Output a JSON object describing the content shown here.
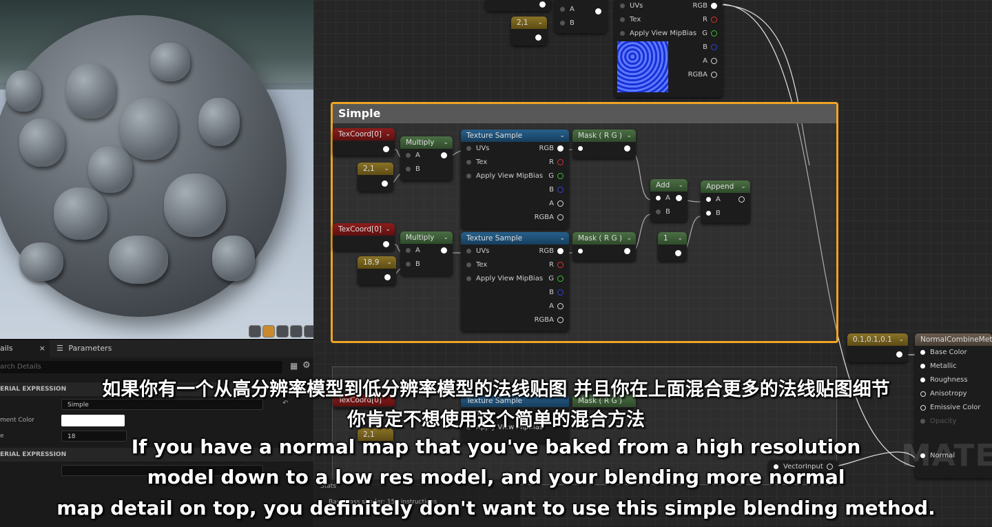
{
  "viewport": {
    "toolbar_buttons": [
      "cylinder-icon",
      "sphere-icon",
      "plane-icon",
      "cube-icon",
      "mesh-icon"
    ]
  },
  "details": {
    "tabs": [
      {
        "label": "ails"
      },
      {
        "label": "Parameters"
      }
    ],
    "close_glyph": "×",
    "search_placeholder": "arch Details",
    "section1": "ERIAL EXPRESSION",
    "desc_value": "Simple",
    "color_label": "ment Color",
    "size_label": "e",
    "size_value": "18",
    "section2": "ERIAL EXPRESSION"
  },
  "stats": {
    "title": "Stats",
    "line": "Base pass shader: 153 instructions"
  },
  "graph": {
    "top_nodes": {
      "constant_top": "2,1",
      "mult_a": "A",
      "mult_b": "B",
      "tex_uvs": "UVs",
      "tex_tex": "Tex",
      "tex_mip": "Apply View MipBias",
      "out_rgb": "RGB",
      "out_r": "R",
      "out_g": "G",
      "out_b": "B",
      "out_a": "A",
      "out_rgba": "RGBA"
    },
    "comment_title": "Simple",
    "texcoord1": "TexCoord[0]",
    "texcoord2": "TexCoord[0]",
    "multiply1": "Multiply",
    "multiply2": "Multiply",
    "const1": "2,1",
    "const2": "18,9",
    "texsample1": "Texture Sample",
    "texsample2": "Texture Sample",
    "mask1": "Mask ( R G )",
    "mask2": "Mask ( R G )",
    "add": "Add",
    "append": "Append",
    "const_one": "1",
    "pin_a": "A",
    "pin_b": "B",
    "pin_uvs": "UVs",
    "pin_tex": "Tex",
    "pin_mip": "Apply View MipBias",
    "pin_rgb": "RGB",
    "pin_r": "R",
    "pin_g": "G",
    "pin_b2": "B",
    "pin_a2": "A",
    "pin_rgba": "RGBA",
    "vector_const": "0.1,0.1,0.1",
    "vector_input": "VectorInput",
    "result": {
      "title": "NormalCombineMetho",
      "pins": [
        "Base Color",
        "Metallic",
        "Roughness",
        "Anisotropy",
        "Emissive Color",
        "Opacity",
        "Normal"
      ]
    },
    "lower_texcoord": "TexCoord[0]",
    "lower_texsample": "Texture Sample",
    "lower_mask": "Mask ( R G )",
    "lower_const": "2,1",
    "lower_tex": "Tex",
    "lower_mip": "Apply View MipBias"
  },
  "watermark": "MATER",
  "subtitles": {
    "cn_line1": "如果你有一个从高分辨率模型到低分辨率模型的法线贴图 并且你在上面混合更多的法线贴图细节",
    "cn_line2": "你肯定不想使用这个简单的混合方法",
    "en_line1": "If you have a normal map that you've baked from a high resolution",
    "en_line2": "model down to a low res model, and your blending more normal",
    "en_line3": "map detail on top, you definitely don't want to use this simple blending method."
  }
}
